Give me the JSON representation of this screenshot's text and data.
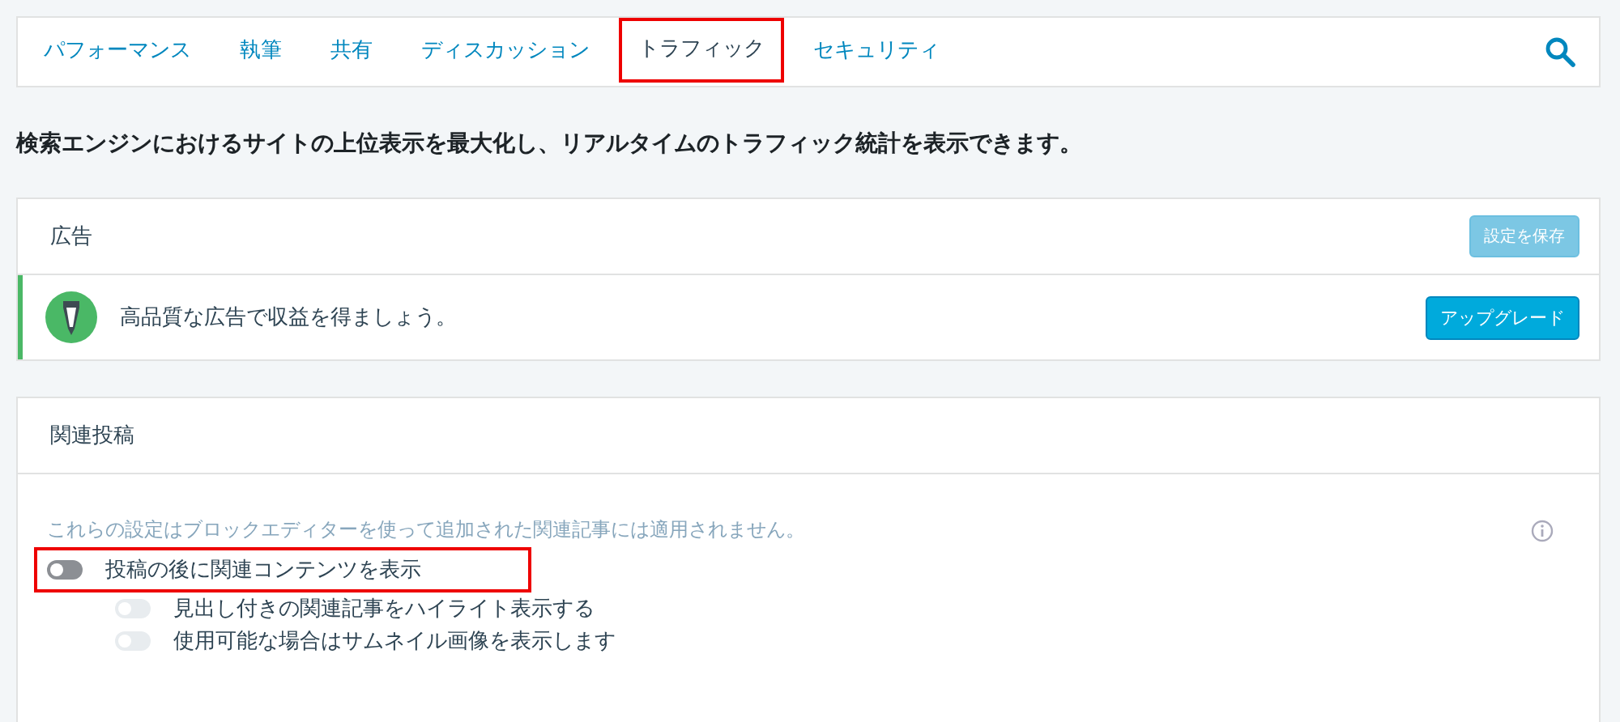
{
  "tabs": [
    {
      "label": "パフォーマンス",
      "selected": false,
      "highlighted": false
    },
    {
      "label": "執筆",
      "selected": false,
      "highlighted": false
    },
    {
      "label": "共有",
      "selected": false,
      "highlighted": false
    },
    {
      "label": "ディスカッション",
      "selected": false,
      "highlighted": false
    },
    {
      "label": "トラフィック",
      "selected": true,
      "highlighted": true
    },
    {
      "label": "セキュリティ",
      "selected": false,
      "highlighted": false
    }
  ],
  "description": "検索エンジンにおけるサイトの上位表示を最大化し、リアルタイムのトラフィック統計を表示できます。",
  "ads": {
    "title": "広告",
    "save_button": {
      "label": "設定を保存",
      "disabled": true
    },
    "notice": {
      "text": "高品質な広告で収益を得ましょう。",
      "button": "アップグレード"
    }
  },
  "related": {
    "title": "関連投稿",
    "note": "これらの設定はブロックエディターを使って追加された関連記事には適用されません。",
    "toggles": [
      {
        "label": "投稿の後に関連コンテンツを表示",
        "on": false,
        "disabled": false,
        "highlighted": true,
        "children": [
          {
            "label": "見出し付きの関連記事をハイライト表示する",
            "on": false,
            "disabled": true
          },
          {
            "label": "使用可能な場合はサムネイル画像を表示します",
            "on": false,
            "disabled": true
          }
        ]
      }
    ]
  }
}
